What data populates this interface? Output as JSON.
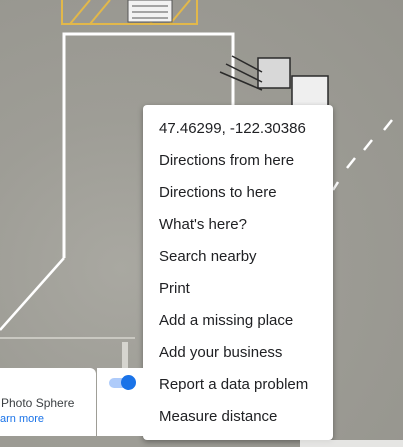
{
  "context_menu": {
    "coordinates": "47.46299, -122.30386",
    "items": [
      "Directions from here",
      "Directions to here",
      "What's here?",
      "Search nearby",
      "Print",
      "Add a missing place",
      "Add your business",
      "Report a data problem",
      "Measure distance"
    ]
  },
  "photo_sphere": {
    "title": "Photo Sphere",
    "link": "arn more",
    "toggle_on": true
  },
  "colors": {
    "accent": "#1a73e8",
    "menu_bg": "#ffffff",
    "map_markings": "#ffffff",
    "safety_lines": "#e2b84a"
  }
}
